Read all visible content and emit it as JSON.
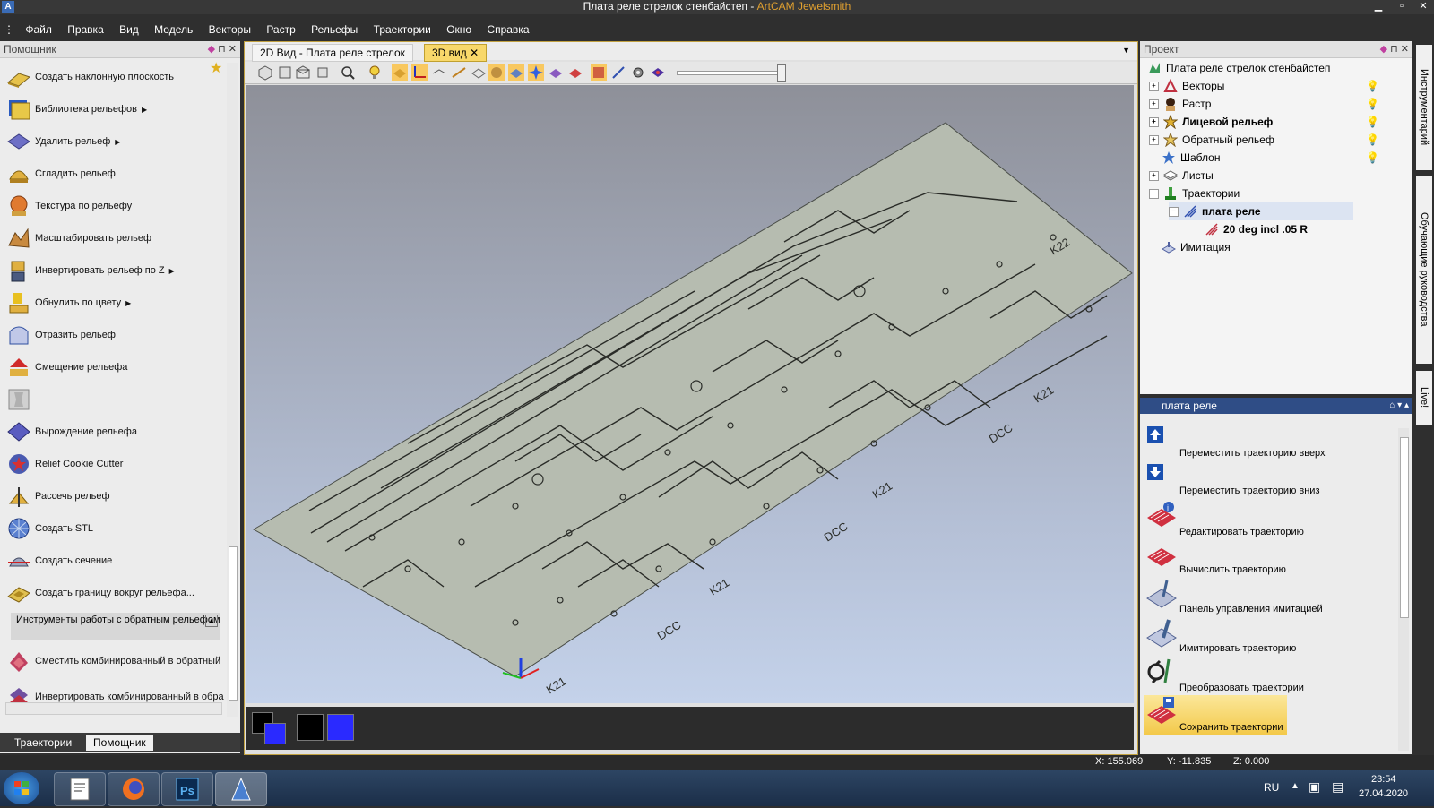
{
  "window": {
    "document_title": "Плата реле стрелок стенбайстеп",
    "separator": " - ",
    "app_name": "ArtCAM Jewelsmith",
    "app_icon_letter": "A"
  },
  "menu": [
    "Файл",
    "Правка",
    "Вид",
    "Модель",
    "Векторы",
    "Растр",
    "Рельефы",
    "Траектории",
    "Окно",
    "Справка"
  ],
  "left_panel": {
    "title": "Помощник",
    "items": [
      {
        "label": "Создать наклонную плоскость",
        "icon": "inclined-plane-icon",
        "submenu": false
      },
      {
        "label": "Библиотека рельефов",
        "icon": "relief-library-icon",
        "submenu": true
      },
      {
        "label": "Удалить рельеф",
        "icon": "delete-relief-icon",
        "submenu": true
      },
      {
        "label": "Сгладить рельеф",
        "icon": "smooth-relief-icon",
        "submenu": false
      },
      {
        "label": "Текстура по рельефу",
        "icon": "texture-relief-icon",
        "submenu": false
      },
      {
        "label": "Масштабировать рельеф",
        "icon": "scale-relief-icon",
        "submenu": false
      },
      {
        "label": "Инвертировать рельеф по Z",
        "icon": "invert-relief-icon",
        "submenu": true
      },
      {
        "label": "Обнулить по цвету",
        "icon": "zero-by-colour-icon",
        "submenu": true
      },
      {
        "label": "Отразить рельеф",
        "icon": "mirror-relief-icon",
        "submenu": false
      },
      {
        "label": "Смещение рельефа",
        "icon": "offset-relief-icon",
        "submenu": false
      },
      {
        "label": "",
        "icon": "blank-tool-icon",
        "submenu": false
      },
      {
        "label": "Вырождение рельефа",
        "icon": "fade-relief-icon",
        "submenu": false
      },
      {
        "label": "Relief Cookie Cutter",
        "icon": "cookie-cutter-icon",
        "submenu": false
      },
      {
        "label": "Рассечь рельеф",
        "icon": "split-relief-icon",
        "submenu": false
      },
      {
        "label": "Создать STL",
        "icon": "create-stl-icon",
        "submenu": false
      },
      {
        "label": "Создать сечение",
        "icon": "create-section-icon",
        "submenu": false
      },
      {
        "label": "Создать границу вокруг рельефа...",
        "icon": "relief-border-icon",
        "submenu": false
      }
    ],
    "section": {
      "title": "Инструменты работы с обратным рельефом",
      "items": [
        {
          "label": "Сместить комбинированный в обратный",
          "icon": "shift-combined-icon"
        },
        {
          "label": "Инвертировать комбинированный в обра",
          "icon": "invert-combined-icon"
        }
      ]
    },
    "tabs": {
      "toolpaths": "Траектории",
      "assistant": "Помощник"
    }
  },
  "doc_tabs": [
    {
      "label": "2D Вид - Плата реле стрелок",
      "active": false
    },
    {
      "label": "3D вид",
      "active": true
    }
  ],
  "viewport_labels": [
    "K21",
    "K21",
    "K21",
    "K21",
    "DCC",
    "DCC",
    "DCC",
    "K22"
  ],
  "colors": {
    "board": "#b6bcb0",
    "swatch_black": "#000000",
    "swatch_blue": "#2a2aff",
    "accent": "#e8b84a",
    "selected_bar": "#2f4d86"
  },
  "project_panel": {
    "title": "Проект",
    "root": "Плата реле стрелок стенбайстеп",
    "nodes": [
      {
        "label": "Векторы",
        "bold": false,
        "level": 1,
        "expander": "+"
      },
      {
        "label": "Растр",
        "bold": false,
        "level": 1,
        "expander": "+"
      },
      {
        "label": "Лицевой рельеф",
        "bold": true,
        "level": 1,
        "expander": "+"
      },
      {
        "label": "Обратный рельеф",
        "bold": false,
        "level": 1,
        "expander": "+"
      },
      {
        "label": "Шаблон",
        "bold": false,
        "level": 1,
        "expander": ""
      },
      {
        "label": "Листы",
        "bold": false,
        "level": 1,
        "expander": "+"
      },
      {
        "label": "Траектории",
        "bold": false,
        "level": 1,
        "expander": "−"
      },
      {
        "label": "плата реле",
        "bold": true,
        "level": 2,
        "expander": "−"
      },
      {
        "label": "20 deg incl .05 R",
        "bold": true,
        "level": 3,
        "expander": ""
      },
      {
        "label": "Имитация",
        "bold": false,
        "level": 1,
        "expander": ""
      }
    ]
  },
  "toolpath_panel": {
    "title": "плата реле",
    "actions": [
      {
        "label": "Переместить траекторию вверх",
        "icon": "move-up-icon"
      },
      {
        "label": "Переместить траекторию вниз",
        "icon": "move-down-icon"
      },
      {
        "label": "Редактировать траекторию",
        "icon": "edit-toolpath-icon"
      },
      {
        "label": "Вычислить траекторию",
        "icon": "calculate-toolpath-icon"
      },
      {
        "label": "Панель управления имитацией",
        "icon": "simulation-panel-icon"
      },
      {
        "label": "Имитировать траекторию",
        "icon": "simulate-toolpath-icon"
      },
      {
        "label": "Преобразовать траектории",
        "icon": "transform-toolpath-icon"
      },
      {
        "label": "Сохранить траектории",
        "icon": "save-toolpath-icon",
        "highlight": true
      }
    ]
  },
  "side_tabs": [
    "Инструментарий",
    "Обучающие руководства",
    "Live!"
  ],
  "status": {
    "x": "X: 155.069",
    "y": "Y: -11.835",
    "z": "Z: 0.000"
  },
  "taskbar": {
    "lang": "RU",
    "time": "23:54",
    "date": "27.04.2020",
    "apps": [
      {
        "name": "notepad",
        "icon": "notepad-icon"
      },
      {
        "name": "firefox",
        "icon": "firefox-icon"
      },
      {
        "name": "Ps",
        "icon": "photoshop-icon"
      },
      {
        "name": "artcam",
        "icon": "artcam-icon"
      }
    ]
  }
}
